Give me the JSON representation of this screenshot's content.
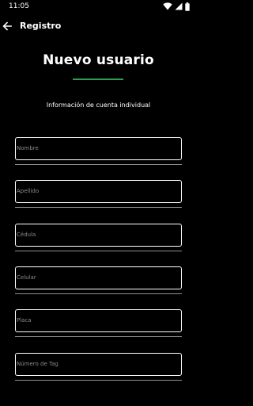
{
  "status_bar": {
    "time": "11:05",
    "icons": [
      "wifi-icon",
      "cell-signal-icon",
      "battery-icon"
    ]
  },
  "app_bar": {
    "back_icon": "arrow-left-icon",
    "title": "Registro"
  },
  "header": {
    "title": "Nuevo usuario",
    "subtitle": "Información de cuenta individual"
  },
  "form": {
    "fields": [
      {
        "placeholder": "Nombre",
        "value": ""
      },
      {
        "placeholder": "Apellido",
        "value": ""
      },
      {
        "placeholder": "Cédula",
        "value": ""
      },
      {
        "placeholder": "Celular",
        "value": ""
      },
      {
        "placeholder": "Placa",
        "value": ""
      },
      {
        "placeholder": "Número de Tag",
        "value": ""
      }
    ]
  },
  "colors": {
    "background": "#000000",
    "accent": "#2e9e50",
    "text": "#ffffff",
    "placeholder": "#8a8a8a"
  }
}
